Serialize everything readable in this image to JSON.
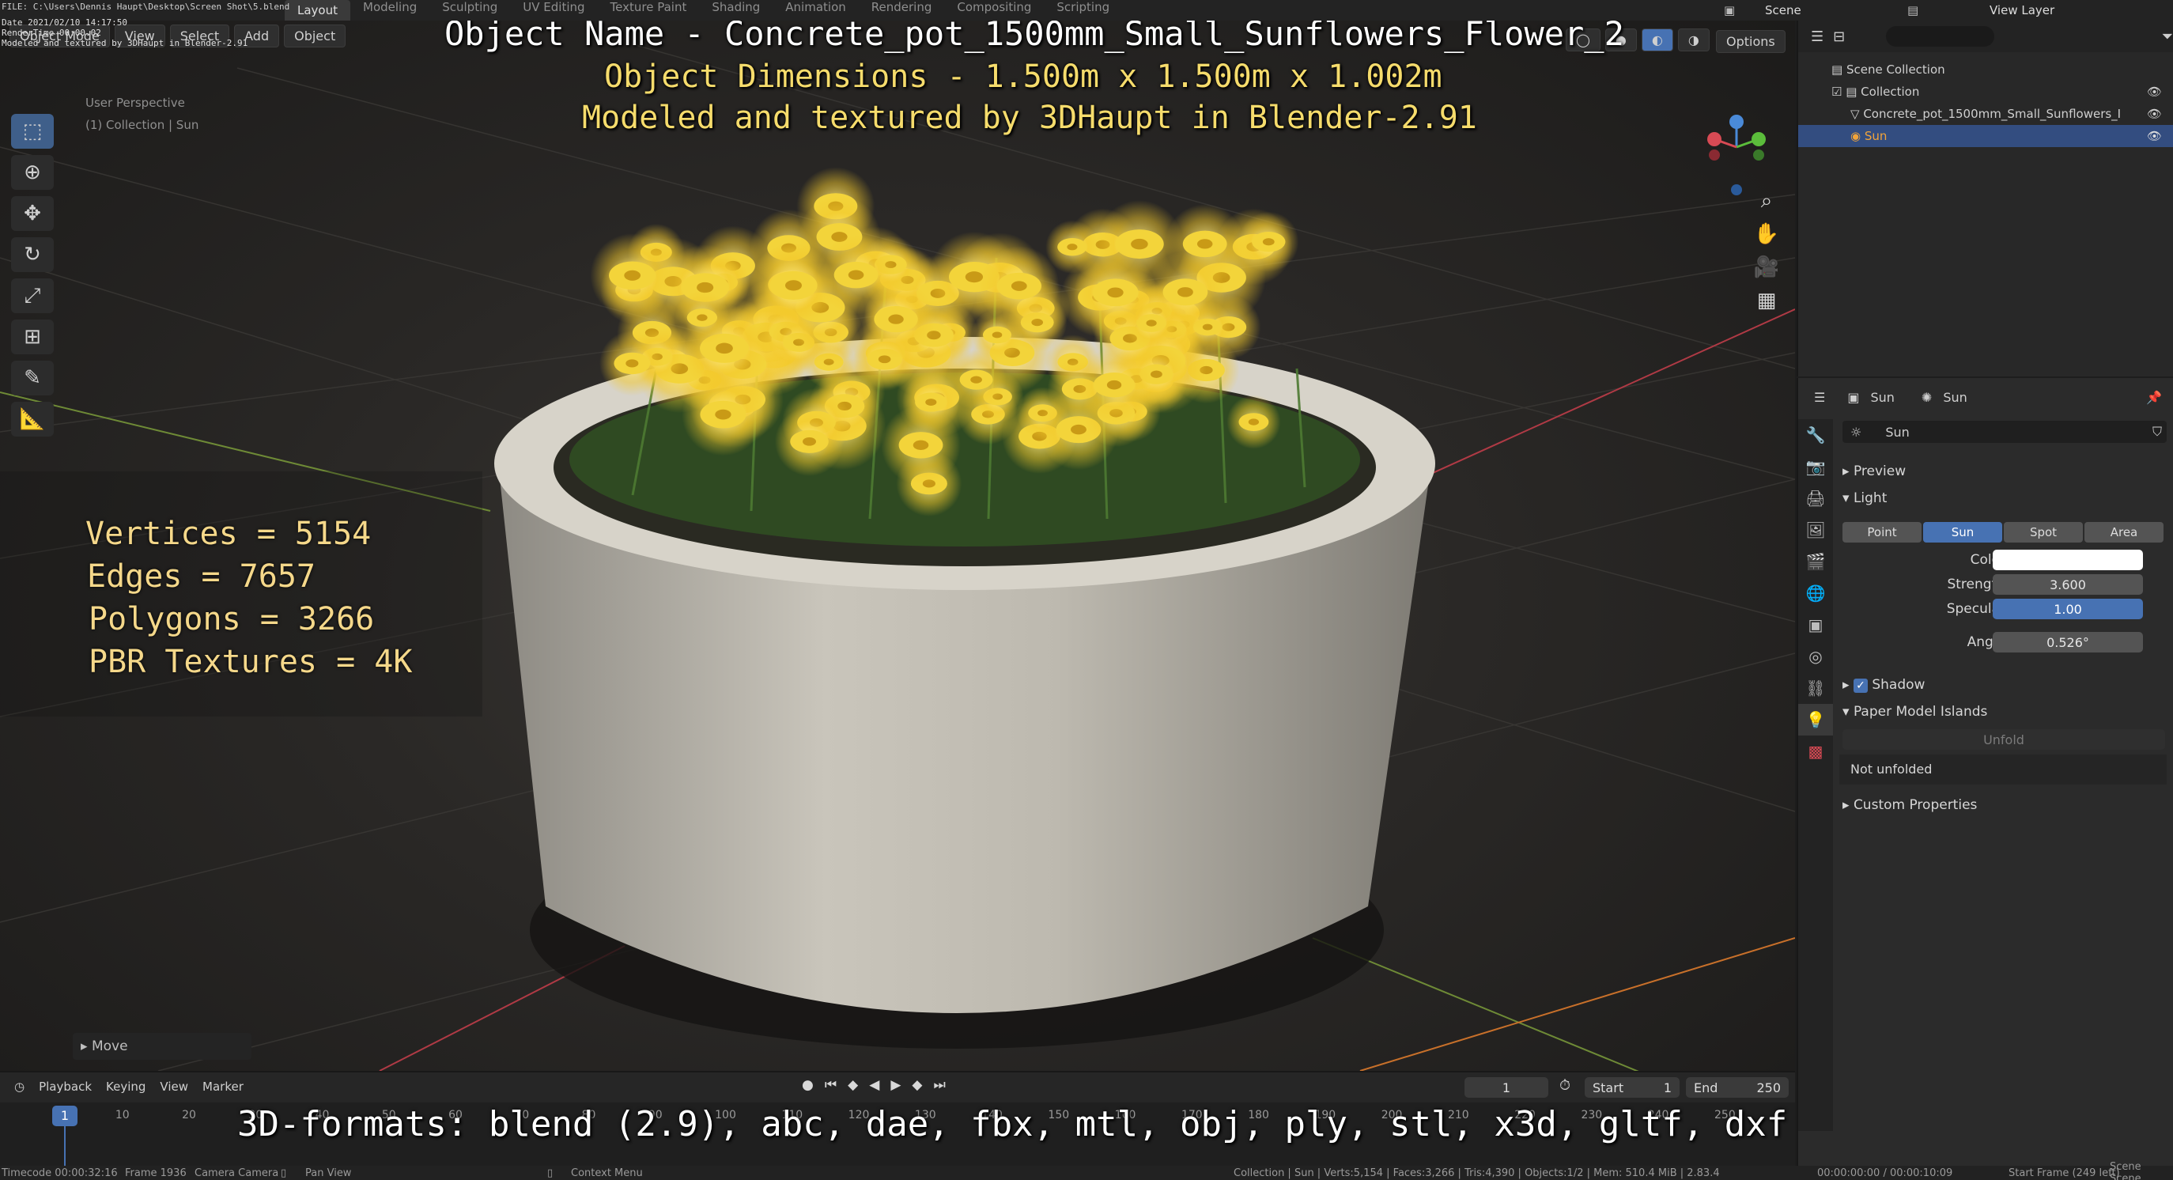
{
  "topbar": {
    "file_path": "FILE: C:\\Users\\Dennis Haupt\\Desktop\\Screen Shot\\5.blend",
    "tabs": [
      "Layout",
      "Modeling",
      "Sculpting",
      "UV Editing",
      "Texture Paint",
      "Shading",
      "Animation",
      "Rendering",
      "Compositing",
      "Scripting"
    ],
    "active_tab": "Layout",
    "scene_label": "Scene",
    "view_layer_label": "View Layer"
  },
  "render_stamp": {
    "date": "Date 2021/02/10 14:17:50",
    "rendertime": "RenderTime 00:00.02",
    "note": "Modeled and textured by 3DHaupt in Blender-2.91"
  },
  "viewport_header": {
    "mode": "Object Mode",
    "menus": [
      "View",
      "Select",
      "Add",
      "Object"
    ],
    "options_label": "Options"
  },
  "viewport_info": {
    "perspective": "User Perspective",
    "collection": "(1) Collection | Sun"
  },
  "overlay": {
    "object_name": "Object Name - Concrete_pot_1500mm_Small_Sunflowers_Flower_2",
    "dimensions": "Object Dimensions -  1.500m x 1.500m x 1.002m",
    "credits": "Modeled and textured by 3DHaupt in Blender-2.91",
    "stats": [
      "Vertices = 5154",
      "Edges = 7657",
      "Polygons = 3266",
      "PBR Textures = 4K"
    ],
    "formats": "3D-formats: blend (2.9), abc, dae, fbx, mtl, obj, ply, stl, x3d, gltf, dxf"
  },
  "last_operator": "Move",
  "outliner": {
    "root": "Scene Collection",
    "items": [
      {
        "name": "Collection"
      },
      {
        "name": "Concrete_pot_1500mm_Small_Sunflowers_I"
      },
      {
        "name": "Sun"
      }
    ]
  },
  "properties": {
    "breadcrumb_object": "Sun",
    "breadcrumb_data": "Sun",
    "datablock_name": "Sun",
    "sections": {
      "preview": "Preview",
      "light": "Light",
      "shadow": "Shadow",
      "paper_model": "Paper Model Islands",
      "custom": "Custom Properties"
    },
    "light_types": [
      "Point",
      "Sun",
      "Spot",
      "Area"
    ],
    "active_light_type": "Sun",
    "fields": {
      "color_label": "Color",
      "strength_label": "Strength",
      "strength_value": "3.600",
      "specular_label": "Specular",
      "specular_value": "1.00",
      "angle_label": "Angle",
      "angle_value": "0.526°"
    },
    "shadow_checked": true,
    "unfold_button": "Unfold",
    "not_unfolded": "Not unfolded"
  },
  "timeline": {
    "menus": [
      "Playback",
      "Keying",
      "View",
      "Marker"
    ],
    "current_frame": "1",
    "start_label": "Start",
    "start_value": "1",
    "end_label": "End",
    "end_value": "250",
    "ruler_ticks": [
      "1",
      "10",
      "20",
      "30",
      "40",
      "50",
      "60",
      "70",
      "80",
      "90",
      "100",
      "110",
      "120",
      "130",
      "140",
      "150",
      "160",
      "170",
      "180",
      "190",
      "200",
      "210",
      "220",
      "230",
      "240",
      "250"
    ]
  },
  "statusbar": {
    "timecode": "Timecode 00:00:32:16",
    "frame": "Frame 1936",
    "camera": "Camera Camera",
    "pan_view": "Pan View",
    "context_menu": "Context Menu",
    "stats": "Collection | Sun | Verts:5,154 | Faces:3,266 | Tris:4,390 | Objects:1/2 | Mem: 510.4 MiB | 2.83.4",
    "time": "00:00:00:00 / 00:00:10:09",
    "start_frame": "Start Frame (249 left)",
    "scene": "Scene  Scene"
  },
  "colors": {
    "accent": "#4772b3",
    "flower_yellow": "#f3d43a",
    "overlay_yellow": "#f6dc6c"
  }
}
